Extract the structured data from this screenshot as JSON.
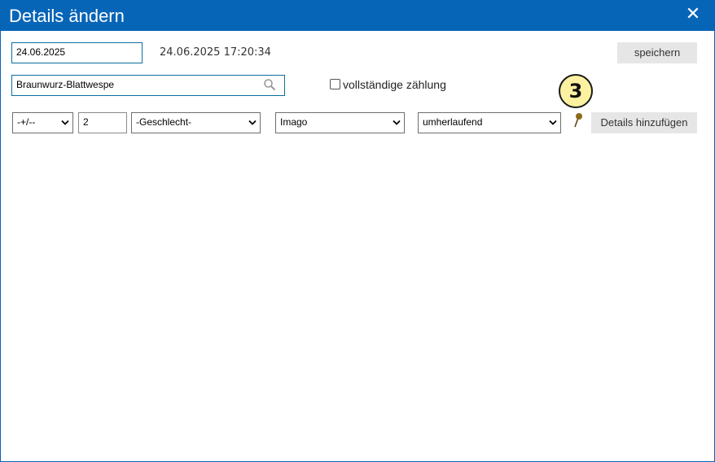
{
  "dialog": {
    "title": "Details ändern",
    "close_symbol": "✕"
  },
  "form": {
    "date_value": "24.06.2025",
    "timestamp": "24.06.2025 17:20:34",
    "save_label": "speichern",
    "species_value": "Braunwurz-Blattwespe",
    "complete_count_label": "vollständige zählung",
    "complete_count_checked": false
  },
  "details_row": {
    "sign_value": "-+/--",
    "count_value": "2",
    "sex_value": "-Geschlecht-",
    "stage_value": "Imago",
    "behaviour_value": "umherlaufend",
    "add_label": "Details hinzufügen"
  },
  "annotation": {
    "badge_number": "3",
    "badge_color": "#fcf1a0"
  },
  "colors": {
    "titlebar": "#0765b7",
    "input_border": "#0b6fa0",
    "button_bg": "#e6e6e6",
    "pin": "#7a5a10"
  },
  "icons": {
    "search": "search-icon",
    "close": "close-icon",
    "dropdown": "chevron-down-icon",
    "pin": "map-pin-icon"
  }
}
